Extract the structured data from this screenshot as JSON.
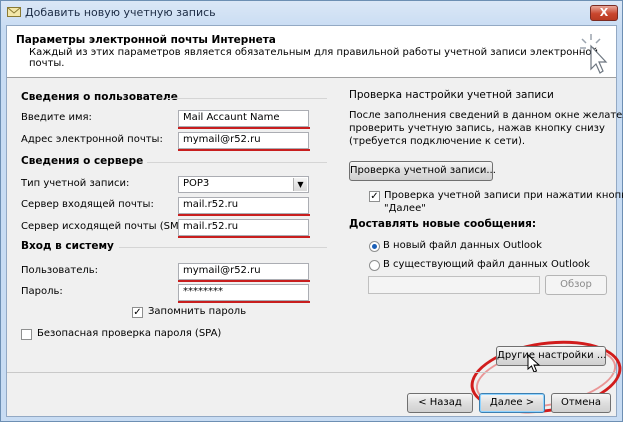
{
  "window": {
    "title": "Добавить новую учетную запись",
    "close_label": "X"
  },
  "header": {
    "title": "Параметры электронной почты Интернета",
    "description": "Каждый из этих параметров является обязательным для правильной работы учетной записи электронной почты."
  },
  "user_info": {
    "section": "Сведения о пользователе",
    "name_label": "Введите имя:",
    "name_value": "Mail Accaunt Name",
    "email_label": "Адрес электронной почты:",
    "email_value": "mymail@r52.ru"
  },
  "server_info": {
    "section": "Сведения о сервере",
    "type_label": "Тип учетной записи:",
    "type_value": "POP3",
    "incoming_label": "Сервер входящей почты:",
    "incoming_value": "mail.r52.ru",
    "outgoing_label": "Сервер исходящей почты (SMTP):",
    "outgoing_value": "mail.r52.ru"
  },
  "login": {
    "section": "Вход в систему",
    "user_label": "Пользователь:",
    "user_value": "mymail@r52.ru",
    "password_label": "Пароль:",
    "password_value": "********",
    "remember_label": "Запомнить пароль",
    "remember_checked": true,
    "spa_label": "Безопасная проверка пароля (SPA)",
    "spa_checked": false
  },
  "test": {
    "section": "Проверка настройки учетной записи",
    "description_lines": [
      "После заполнения сведений в данном окне желательно",
      "проверить учетную запись, нажав кнопку снизу",
      "(требуется подключение к сети)."
    ],
    "test_button": "Проверка учетной записи...",
    "auto_test_lines": [
      "Проверка учетной записи при нажатии кнопки",
      "\"Далее\""
    ],
    "auto_test_checked": true
  },
  "deliver": {
    "section": "Доставлять новые сообщения:",
    "option_new": "В новый файл данных Outlook",
    "option_existing": "В существующий файл данных Outlook",
    "selected": "new",
    "browse_button": "Обзор"
  },
  "more_settings_button": "Другие настройки ...",
  "footer": {
    "back_button": "< Назад",
    "next_button": "Далее >",
    "cancel_button": "Отмена"
  },
  "colors": {
    "highlight": "#c81e1e",
    "title_bar": "#c8dcf3",
    "close_button": "#c9462e"
  }
}
